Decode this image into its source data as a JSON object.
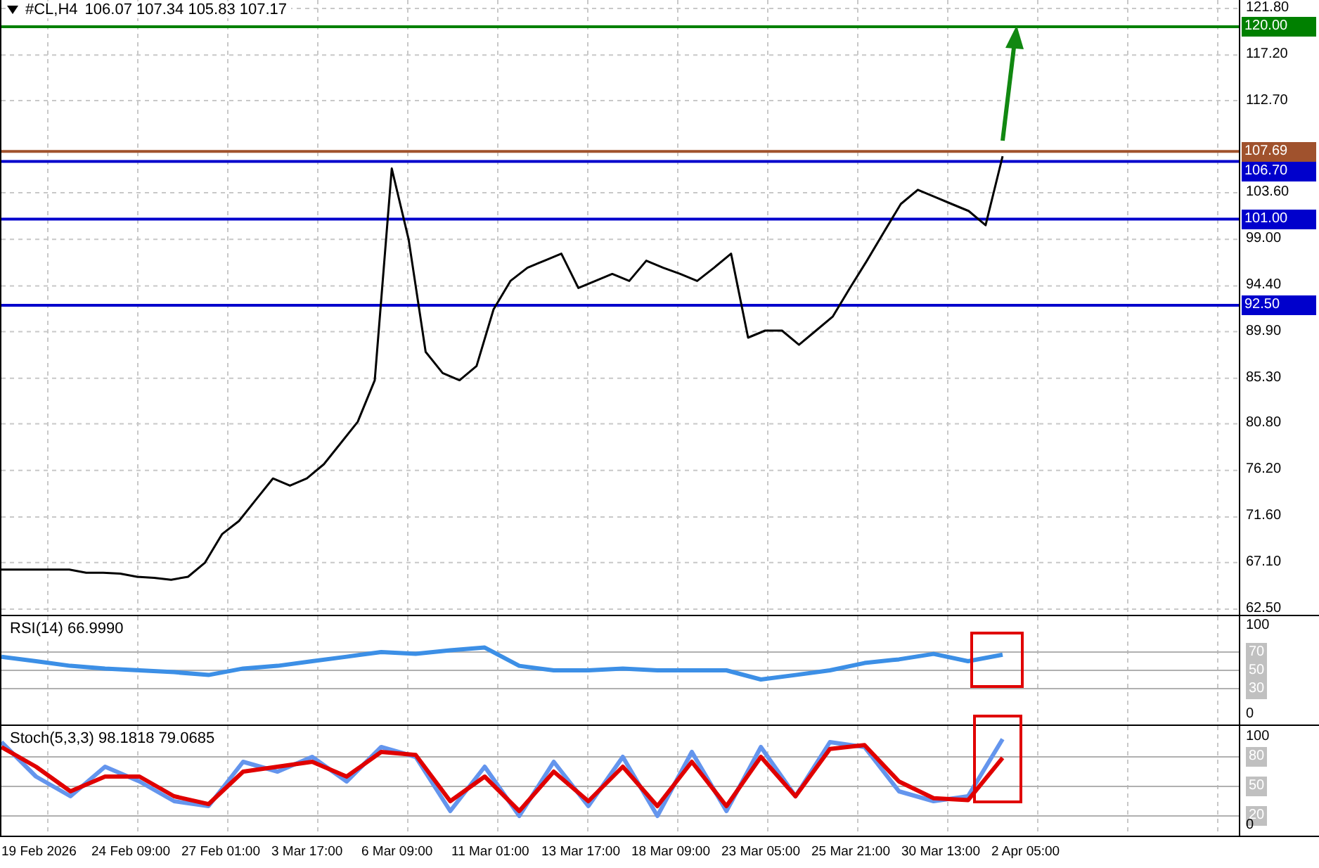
{
  "header": {
    "quote": "106.07 107.34 105.83 107.17"
  },
  "main": {
    "chart_data": {
      "type": "line",
      "ylim": [
        62.5,
        121.8
      ],
      "yticks": [
        {
          "value": 121.8,
          "label": "121.80"
        },
        {
          "value": 117.2,
          "label": "117.20"
        },
        {
          "value": 112.7,
          "label": "112.70"
        },
        {
          "value": 103.6,
          "label": "103.60"
        },
        {
          "value": 99,
          "label": "99.00"
        },
        {
          "value": 94.4,
          "label": "94.40"
        },
        {
          "value": 89.9,
          "label": "89.90"
        },
        {
          "value": 85.3,
          "label": "85.30"
        },
        {
          "value": 80.8,
          "label": "80.80"
        },
        {
          "value": 76.2,
          "label": "76.20"
        },
        {
          "value": 71.6,
          "label": "71.60"
        },
        {
          "value": 67.1,
          "label": "67.10"
        },
        {
          "value": 62.5,
          "label": "62.50"
        }
      ],
      "series": [
        {
          "name": "#CL,H4",
          "color": "#000000",
          "values": [
            66.4,
            66.4,
            66.4,
            66.4,
            66.4,
            66.1,
            66.1,
            66.0,
            65.7,
            65.6,
            65.4,
            65.7,
            67.1,
            69.9,
            71.2,
            73.3,
            75.4,
            74.7,
            75.4,
            76.8,
            78.9,
            81.0,
            85.1,
            106.0,
            99.0,
            87.9,
            85.8,
            85.1,
            86.5,
            92.1,
            94.9,
            96.2,
            96.9,
            97.6,
            94.2,
            94.9,
            95.6,
            94.9,
            96.9,
            96.2,
            95.6,
            94.9,
            96.2,
            97.6,
            89.3,
            90.0,
            90.0,
            88.6,
            90.0,
            91.4,
            94.2,
            96.9,
            99.7,
            102.5,
            103.9,
            103.2,
            102.5,
            101.8,
            100.4,
            107.2
          ]
        }
      ],
      "grid": true,
      "ref_lines": [
        {
          "axis": "y",
          "value": 120,
          "label": "120.00",
          "color": "#008000"
        },
        {
          "axis": "y",
          "value": 107.69,
          "label": "107.69",
          "color": "#a0522d"
        },
        {
          "axis": "y",
          "value": 106.7,
          "label": "106.70",
          "color": "#0000cc"
        },
        {
          "axis": "y",
          "value": 101,
          "label": "101.00",
          "color": "#0000cc"
        },
        {
          "axis": "y",
          "value": 92.5,
          "label": "92.50",
          "color": "#0000cc"
        }
      ]
    }
  },
  "rsi": {
    "chart_data": {
      "type": "line",
      "grid": true,
      "title": "RSI(14) 66.9990",
      "ylim": [
        0,
        100
      ],
      "yticks": [
        {
          "value": 100,
          "label": "100"
        },
        {
          "value": 70,
          "label": "70"
        },
        {
          "value": 50,
          "label": "50"
        },
        {
          "value": 30,
          "label": "30"
        },
        {
          "value": 0,
          "label": "0"
        }
      ],
      "series": [
        {
          "color": "#3c8fe6",
          "values": [
            65,
            60,
            55,
            52,
            50,
            48,
            45,
            52,
            55,
            60,
            65,
            70,
            68,
            72,
            75,
            55,
            50,
            50,
            52,
            50,
            50,
            50,
            40,
            45,
            50,
            58,
            62,
            68,
            60,
            67
          ]
        }
      ]
    }
  },
  "stoch": {
    "chart_data": {
      "type": "line",
      "grid": true,
      "title": "Stoch(5,3,3) 98.1818 79.0685",
      "ylim": [
        0,
        100
      ],
      "yticks": [
        {
          "value": 100,
          "label": "100"
        },
        {
          "value": 80,
          "label": "80"
        },
        {
          "value": 50,
          "label": "50"
        },
        {
          "value": 20,
          "label": "20"
        },
        {
          "value": 0,
          "label": "0"
        }
      ],
      "series": [
        {
          "color": "#6495ed",
          "values": [
            95,
            60,
            40,
            70,
            55,
            35,
            30,
            75,
            65,
            80,
            55,
            90,
            80,
            25,
            70,
            20,
            75,
            30,
            80,
            20,
            85,
            25,
            90,
            40,
            95,
            90,
            45,
            35,
            40,
            98
          ]
        },
        {
          "color": "#e00000",
          "values": [
            90,
            70,
            45,
            60,
            60,
            40,
            32,
            65,
            70,
            75,
            60,
            85,
            82,
            35,
            60,
            25,
            65,
            35,
            70,
            30,
            75,
            30,
            80,
            40,
            88,
            92,
            55,
            38,
            36,
            79
          ]
        }
      ]
    }
  },
  "time_axis": {
    "labels": [
      "19 Feb 2026",
      "24 Feb 09:00",
      "27 Feb 01:00",
      "3 Mar 17:00",
      "6 Mar 09:00",
      "11 Mar 01:00",
      "13 Mar 17:00",
      "18 Mar 09:00",
      "23 Mar 05:00",
      "25 Mar 21:00",
      "30 Mar 13:00",
      "2 Apr 05:00"
    ]
  }
}
